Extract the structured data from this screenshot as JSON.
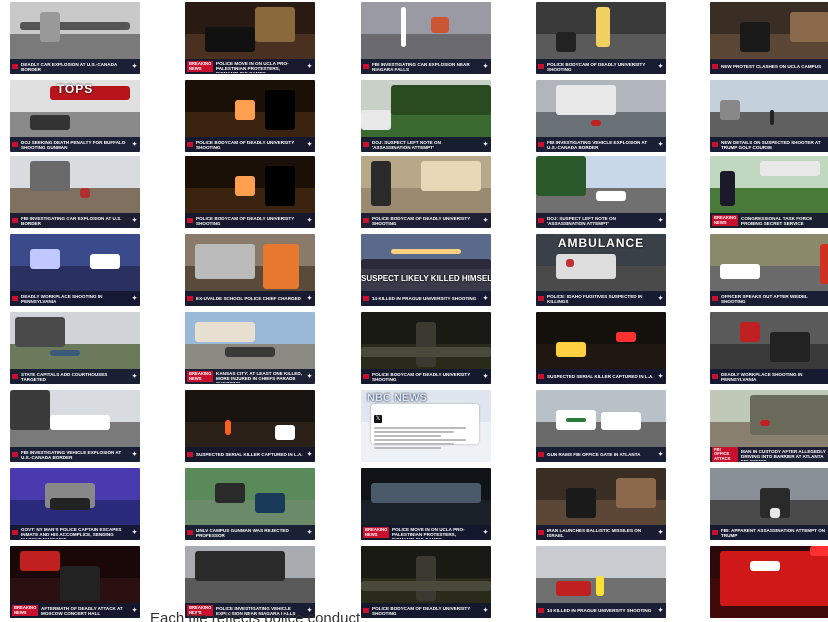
{
  "caption": "Each tile reflects police conduct",
  "tiles": [
    {
      "headline": "Deadly car explosion at U.S.-Canada border",
      "badge": "",
      "logo": "nbc",
      "scene": "border"
    },
    {
      "headline": "Police move in on UCLA pro-Palestinian protesters, dismantling camps",
      "badge": "Breaking News",
      "logo": "nbc",
      "scene": "night"
    },
    {
      "headline": "FBI investigating car explosion near Niagara Falls",
      "badge": "",
      "logo": "nbc",
      "scene": "cctv"
    },
    {
      "headline": "Police bodycam of deadly university shooting",
      "badge": "",
      "logo": "nbc",
      "scene": "campus"
    },
    {
      "headline": "New protest clashes on UCLA campus",
      "badge": "",
      "logo": "nbc",
      "scene": "protest"
    },
    {
      "headline": "DOJ seeking death penalty for Buffalo shooting gunman",
      "badge": "",
      "logo": "nbc",
      "scene": "tops",
      "overlay_top": "TOPS"
    },
    {
      "headline": "Police bodycam of deadly university shooting",
      "badge": "",
      "logo": "nbc",
      "scene": "dark"
    },
    {
      "headline": "DOJ: Suspect left note on 'assassination attempt'",
      "badge": "",
      "logo": "nbc",
      "scene": "hedge"
    },
    {
      "headline": "FBI investigating vehicle explosion at U.S.-Canada border",
      "badge": "",
      "logo": "nbc",
      "scene": "garage"
    },
    {
      "headline": "New details on suspected shooter at Trump golf course",
      "badge": "",
      "logo": "nbc",
      "scene": "street"
    },
    {
      "headline": "FBI investigating car explosion at U.S. border",
      "badge": "",
      "logo": "nbc",
      "scene": "tree"
    },
    {
      "headline": "Police bodycam of deadly university shooting",
      "badge": "",
      "logo": "nbc",
      "scene": "dark"
    },
    {
      "headline": "Police bodycam of deadly university shooting",
      "badge": "",
      "logo": "nbc",
      "scene": "stairs"
    },
    {
      "headline": "DOJ: Suspect left note on 'assassination attempt'",
      "badge": "",
      "logo": "nbc",
      "scene": "palm"
    },
    {
      "headline": "Congressional task force probing Secret Service",
      "badge": "Breaking News",
      "logo": "nbc",
      "scene": "field"
    },
    {
      "headline": "Deadly workplace shooting in Pennsylvania",
      "badge": "",
      "logo": "nbc",
      "scene": "blurblue"
    },
    {
      "headline": "Ex-Uvalde school police chief charged",
      "badge": "",
      "logo": "nbc",
      "scene": "mugshot"
    },
    {
      "headline": "14 killed in Prague university shooting",
      "badge": "",
      "logo": "nbc",
      "scene": "dusk",
      "overlay_mid": "SUSPECT LIKELY KILLED HIMSELF"
    },
    {
      "headline": "Police: Idaho fugitives suspected in killings",
      "badge": "",
      "logo": "nbc",
      "scene": "ambulance",
      "overlay_top": "AMBULANCE"
    },
    {
      "headline": "Officer speaks out after Weidel shooting",
      "badge": "",
      "logo": "nbc",
      "scene": "cruisers"
    },
    {
      "headline": "State capitals add courthouses targeted",
      "badge": "",
      "logo": "nbc",
      "scene": "park"
    },
    {
      "headline": "Kansas City: at least one killed, more injured in Chiefs parade shooting",
      "badge": "Breaking News",
      "logo": "nbc",
      "scene": "plaza"
    },
    {
      "headline": "Police bodycam of deadly university shooting",
      "badge": "",
      "logo": "nbc",
      "scene": "darkman"
    },
    {
      "headline": "Suspected serial killer captured in L.A.",
      "badge": "",
      "logo": "nbc",
      "scene": "siren"
    },
    {
      "headline": "Deadly workplace shooting in Pennsylvania",
      "badge": "",
      "logo": "nbc",
      "scene": "crowd"
    },
    {
      "headline": "FBI investigating vehicle explosion at U.S.-Canada border",
      "badge": "",
      "logo": "nbc",
      "scene": "lot"
    },
    {
      "headline": "Suspected serial killer captured in L.A.",
      "badge": "",
      "logo": "nbc",
      "scene": "cones"
    },
    {
      "headline": "",
      "badge": "",
      "logo": "",
      "scene": "tweet",
      "overlay_nbc": "NBC NEWS"
    },
    {
      "headline": "Gun rams FBI office gate in Atlanta",
      "badge": "",
      "logo": "nbc",
      "scene": "patrol"
    },
    {
      "headline": "Man in custody after allegedly driving into barrier at Atlanta FBI office",
      "badge": "FBI Office Attack",
      "logo": "nbc",
      "scene": "roof"
    },
    {
      "headline": "Govt: NY man's police captain escapes inmate and his accomplice, sending massive manhunt",
      "badge": "",
      "logo": "nbc",
      "scene": "purple"
    },
    {
      "headline": "UNLV campus gunman was rejected professor",
      "badge": "",
      "logo": "nbc",
      "scene": "aerial"
    },
    {
      "headline": "Police move in on UCLA pro-Palestinian protesters, dismantling camps",
      "badge": "Breaking News",
      "logo": "nbc",
      "scene": "nightcrowd"
    },
    {
      "headline": "Iran launches ballistic missiles on Israel",
      "badge": "",
      "logo": "nbc",
      "scene": "protest"
    },
    {
      "headline": "FBI: Apparent assassination attempt on Trump",
      "badge": "",
      "logo": "nbc",
      "scene": "lanes"
    },
    {
      "headline": "Aftermath of deadly attack at Moscow concert hall",
      "badge": "Breaking News",
      "logo": "nbc",
      "scene": "redglow"
    },
    {
      "headline": "Police investigating vehicle explosion near Niagara Falls",
      "badge": "Breaking News",
      "logo": "nbc",
      "scene": "branches"
    },
    {
      "headline": "Police bodycam of deadly university shooting",
      "badge": "",
      "logo": "nbc",
      "scene": "darkman"
    },
    {
      "headline": "14 killed in Prague university shooting",
      "badge": "",
      "logo": "nbc",
      "scene": "redcar"
    },
    {
      "headline": "",
      "badge": "",
      "logo": "",
      "scene": "firetruck"
    }
  ],
  "scenes": {
    "border": {
      "sky": "#c9c9c9",
      "ground": "#7a7a7a",
      "blobs": [
        [
          "#555",
          10,
          20,
          110,
          8
        ],
        [
          "#999",
          30,
          10,
          20,
          30
        ]
      ]
    },
    "night": {
      "sky": "#2a1a14",
      "ground": "#4a3020",
      "blobs": [
        [
          "#8a6a3a",
          70,
          5,
          40,
          35
        ],
        [
          "#111",
          20,
          25,
          50,
          25
        ]
      ]
    },
    "cctv": {
      "sky": "#9a9aa4",
      "ground": "#6a6a70",
      "blobs": [
        [
          "#c53",
          70,
          15,
          18,
          16
        ],
        [
          "#fff",
          40,
          5,
          5,
          40
        ]
      ]
    },
    "campus": {
      "sky": "#3a3a3a",
      "ground": "#5a5a5a",
      "blobs": [
        [
          "#f0d060",
          60,
          5,
          14,
          40
        ],
        [
          "#222",
          20,
          30,
          20,
          20
        ]
      ]
    },
    "protest": {
      "sky": "#3a2e24",
      "ground": "#5c4636",
      "blobs": [
        [
          "#1a1a1a",
          30,
          20,
          30,
          30
        ],
        [
          "#8a6a4a",
          80,
          10,
          40,
          30
        ]
      ]
    },
    "tops": {
      "sky": "#e0e0e0",
      "ground": "#8a8a8a",
      "blobs": [
        [
          "#b8141c",
          40,
          6,
          80,
          14
        ],
        [
          "#333",
          20,
          35,
          40,
          15
        ]
      ]
    },
    "dark": {
      "sky": "#1a1008",
      "ground": "#3a2410",
      "blobs": [
        [
          "#ffa050",
          50,
          20,
          20,
          20
        ],
        [
          "#000",
          80,
          10,
          30,
          40
        ]
      ]
    },
    "hedge": {
      "sky": "#c8d0c8",
      "ground": "#3a6a30",
      "blobs": [
        [
          "#e8e8e8",
          0,
          30,
          30,
          20
        ],
        [
          "#2a4a20",
          30,
          5,
          100,
          30
        ]
      ]
    },
    "garage": {
      "sky": "#b0b6bc",
      "ground": "#6a7278",
      "blobs": [
        [
          "#e8e8e8",
          20,
          5,
          60,
          30
        ],
        [
          "#c02020",
          55,
          40,
          10,
          6
        ]
      ]
    },
    "street": {
      "sky": "#c4d0dc",
      "ground": "#606060",
      "blobs": [
        [
          "#888",
          10,
          20,
          20,
          20
        ],
        [
          "#222",
          60,
          30,
          4,
          15
        ]
      ]
    },
    "tree": {
      "sky": "#d8dce0",
      "ground": "#807060",
      "blobs": [
        [
          "#6a6a6a",
          20,
          5,
          40,
          30
        ],
        [
          "#b03030",
          70,
          32,
          10,
          10
        ]
      ]
    },
    "stairs": {
      "sky": "#b8a88a",
      "ground": "#9a8a70",
      "blobs": [
        [
          "#2a2a2a",
          10,
          5,
          20,
          45
        ],
        [
          "#e8d8b8",
          60,
          5,
          60,
          30
        ]
      ]
    },
    "palm": {
      "sky": "#c8d8e8",
      "ground": "#707070",
      "blobs": [
        [
          "#2a5a2a",
          0,
          0,
          50,
          40
        ],
        [
          "#fff",
          60,
          35,
          30,
          10
        ]
      ]
    },
    "field": {
      "sky": "#c0d8c0",
      "ground": "#4a7a3a",
      "blobs": [
        [
          "#1a1a2a",
          10,
          15,
          15,
          35
        ],
        [
          "#e8e8e8",
          50,
          5,
          60,
          15
        ]
      ]
    },
    "blurblue": {
      "sky": "#3a4a8a",
      "ground": "#2a3060",
      "blobs": [
        [
          "#c0c8ff",
          20,
          15,
          30,
          20
        ],
        [
          "#fff",
          80,
          20,
          30,
          15
        ]
      ]
    },
    "mugshot": {
      "sky": "#8a7a6a",
      "ground": "#5a4a3a",
      "blobs": [
        [
          "#e87830",
          78,
          10,
          36,
          45
        ],
        [
          "#bbb",
          10,
          10,
          60,
          35
        ]
      ]
    },
    "dusk": {
      "sky": "#5a6a8a",
      "ground": "#3a3a4a",
      "blobs": [
        [
          "#ffd080",
          30,
          15,
          70,
          5
        ],
        [
          "#2a2a3a",
          0,
          25,
          130,
          10
        ]
      ]
    },
    "ambulance": {
      "sky": "#3a4048",
      "ground": "#4a4a4a",
      "blobs": [
        [
          "#dddddd",
          20,
          20,
          60,
          25
        ],
        [
          "#c03030",
          30,
          25,
          8,
          8
        ]
      ]
    },
    "cruisers": {
      "sky": "#8a8a6a",
      "ground": "#6a6a6a",
      "blobs": [
        [
          "#fff",
          10,
          30,
          40,
          15
        ],
        [
          "#d03020",
          110,
          10,
          20,
          40
        ]
      ]
    },
    "park": {
      "sky": "#d0d4d8",
      "ground": "#6a7a5a",
      "blobs": [
        [
          "#4a4a4a",
          5,
          5,
          50,
          30
        ],
        [
          "#3a5a7a",
          40,
          38,
          30,
          6
        ]
      ]
    },
    "plaza": {
      "sky": "#9ab8d8",
      "ground": "#8a8a80",
      "blobs": [
        [
          "#e8e0d0",
          10,
          10,
          60,
          20
        ],
        [
          "#3a3a3a",
          40,
          35,
          50,
          10
        ]
      ]
    },
    "darkman": {
      "sky": "#1a1a14",
      "ground": "#2a2a1a",
      "blobs": [
        [
          "#3a3a30",
          55,
          10,
          20,
          45
        ],
        [
          "#4a4a3a",
          0,
          35,
          130,
          10
        ]
      ]
    },
    "siren": {
      "sky": "#14100c",
      "ground": "#201810",
      "blobs": [
        [
          "#ffd040",
          20,
          30,
          30,
          15
        ],
        [
          "#ff3030",
          80,
          20,
          20,
          10
        ]
      ]
    },
    "crowd": {
      "sky": "#5a5a5a",
      "ground": "#3a3a3a",
      "blobs": [
        [
          "#c02020",
          30,
          10,
          20,
          20
        ],
        [
          "#222",
          60,
          20,
          40,
          30
        ]
      ]
    },
    "lot": {
      "sky": "#d8dce0",
      "ground": "#7a7a7a",
      "blobs": [
        [
          "#3a3a3a",
          0,
          0,
          40,
          40
        ],
        [
          "#fff",
          40,
          25,
          60,
          15
        ]
      ]
    },
    "cones": {
      "sky": "#1a1410",
      "ground": "#2a2018",
      "blobs": [
        [
          "#ff6020",
          40,
          30,
          6,
          15
        ],
        [
          "#fff",
          90,
          35,
          20,
          15
        ]
      ]
    },
    "tweet": {
      "sky": "#dfe6ef",
      "ground": "#eef1f5",
      "blobs": []
    },
    "patrol": {
      "sky": "#b8c0c8",
      "ground": "#6a6a6a",
      "blobs": [
        [
          "#fff",
          20,
          20,
          40,
          20
        ],
        [
          "#fff",
          65,
          22,
          40,
          18
        ],
        [
          "#2a7a3a",
          30,
          28,
          20,
          4
        ]
      ]
    },
    "roof": {
      "sky": "#c0c8b8",
      "ground": "#8a8070",
      "blobs": [
        [
          "#6a6a5a",
          40,
          5,
          80,
          40
        ],
        [
          "#c02020",
          50,
          30,
          10,
          6
        ]
      ]
    },
    "purple": {
      "sky": "#4a3ab0",
      "ground": "#2a2a7a",
      "blobs": [
        [
          "#888",
          35,
          15,
          50,
          25
        ],
        [
          "#222",
          40,
          30,
          40,
          12
        ]
      ]
    },
    "aerial": {
      "sky": "#5a8a5a",
      "ground": "#6a8a6a",
      "blobs": [
        [
          "#2a2a2a",
          30,
          15,
          30,
          20
        ],
        [
          "#1a3a5a",
          70,
          25,
          30,
          20
        ]
      ]
    },
    "nightcrowd": {
      "sky": "#101418",
      "ground": "#1a2028",
      "blobs": [
        [
          "#4a5a6a",
          10,
          15,
          110,
          20
        ]
      ]
    },
    "lanes": {
      "sky": "#8a9098",
      "ground": "#4a4a4a",
      "blobs": [
        [
          "#2a2a2a",
          50,
          20,
          30,
          30
        ],
        [
          "#e8e8e8",
          60,
          40,
          10,
          10
        ]
      ]
    },
    "redglow": {
      "sky": "#1a0808",
      "ground": "#2a1010",
      "blobs": [
        [
          "#c02020",
          10,
          5,
          40,
          20
        ],
        [
          "#222",
          50,
          20,
          40,
          35
        ]
      ]
    },
    "branches": {
      "sky": "#a8acb0",
      "ground": "#5a5a5a",
      "blobs": [
        [
          "#2a2a2a",
          10,
          5,
          90,
          30
        ]
      ]
    },
    "redcar": {
      "sky": "#c8ccd0",
      "ground": "#707070",
      "blobs": [
        [
          "#c02020",
          20,
          35,
          35,
          15
        ],
        [
          "#ffe030",
          60,
          30,
          8,
          20
        ]
      ]
    },
    "firetruck": {
      "sky": "#2a0a0a",
      "ground": "#400a0a",
      "blobs": [
        [
          "#d01818",
          10,
          5,
          120,
          55
        ],
        [
          "#fff",
          40,
          15,
          30,
          10
        ],
        [
          "#ff3030",
          100,
          0,
          20,
          10
        ]
      ]
    }
  }
}
